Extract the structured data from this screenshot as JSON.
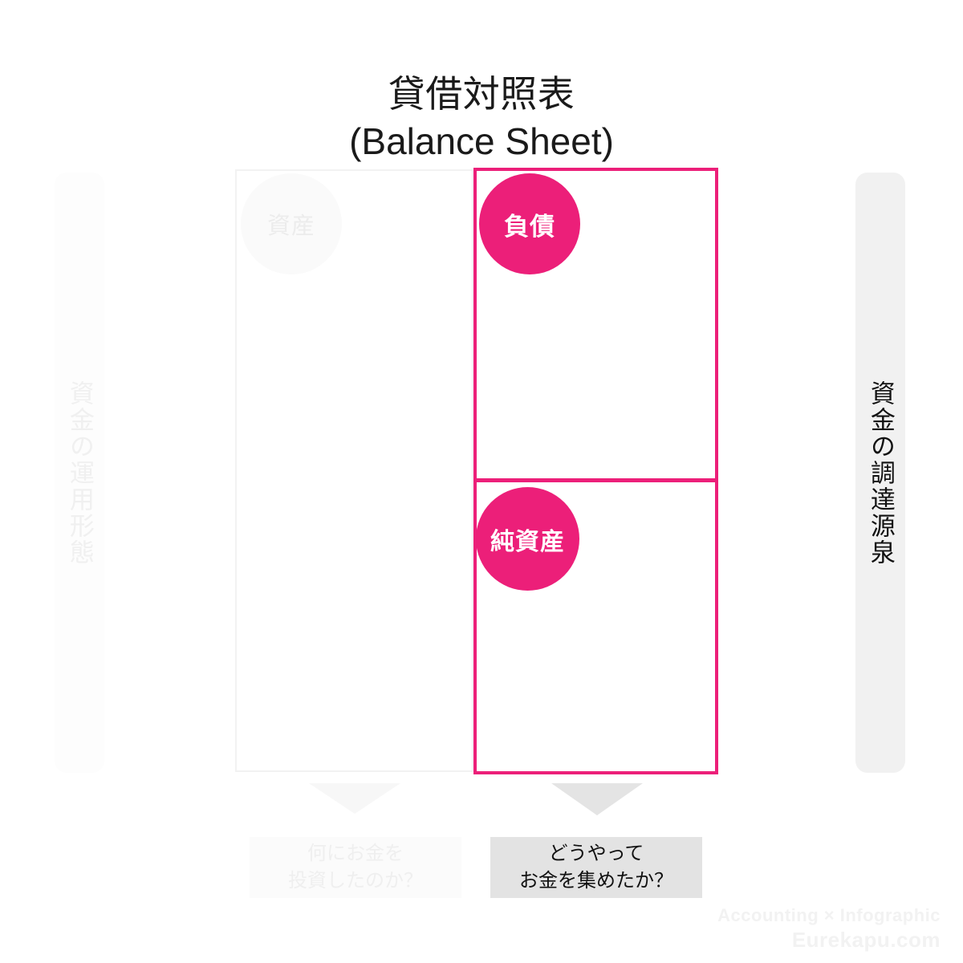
{
  "title": {
    "line1": "貸借対照表",
    "line2": "(Balance Sheet)"
  },
  "rails": {
    "left": {
      "label": "資金の運用形態"
    },
    "right": {
      "label": "資金の調達源泉"
    }
  },
  "balance_sheet": {
    "left_side": {
      "bubble_label": "資産"
    },
    "right_side": {
      "top_bubble_label": "負債",
      "bottom_bubble_label": "純資産"
    }
  },
  "captions": {
    "left": "何にお金を\n投資したのか？",
    "left_line1": "何にお金を",
    "left_line2": "投資したのか？",
    "right": "どうやって\nお金を集めたか？",
    "right_line1": "どうやって",
    "right_line2": "お金を集めたか？"
  },
  "footer": {
    "line1": "Accounting × Infographic",
    "line2": "Eurekapu.com"
  },
  "colors": {
    "accent_pink": "#ec1f79",
    "muted_gray": "#e3e3e3",
    "faint_gray": "#f1f1f1",
    "text_dark": "#111111",
    "ghost_text": "#efefef"
  }
}
